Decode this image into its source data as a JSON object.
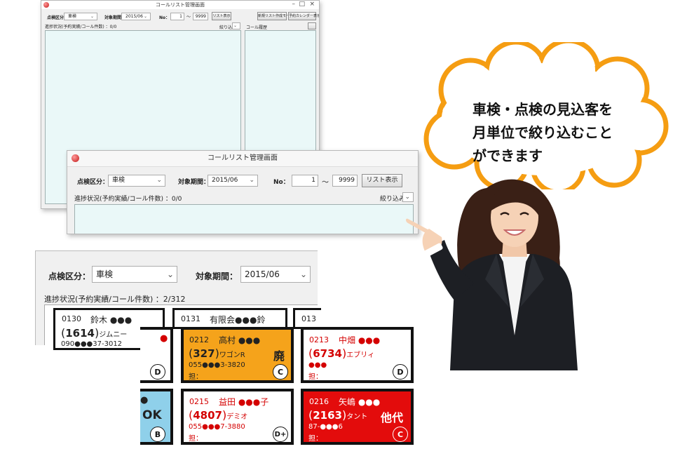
{
  "window_back": {
    "title": "コールリスト管理画面",
    "inspection_label": "点検区分：",
    "inspection_value": "車検",
    "period_label": "対象期間：",
    "period_value": "2015/06",
    "no_label": "No：",
    "no_from": "1",
    "tilde": "～",
    "no_to": "9999",
    "list_button": "リスト表示",
    "new_list_button": "新規リスト作成モード",
    "calendar_button": "予約カレンダー表示",
    "progress": "進捗状況(予約実績/コール件数) ：0/0",
    "filter_label": "絞り込み",
    "history_label": "コール履歴",
    "controls": [
      "–",
      "□",
      "×"
    ]
  },
  "window_front": {
    "title": "コールリスト管理画面",
    "inspection_label": "点検区分：",
    "inspection_value": "車検",
    "period_label": "対象期間：",
    "period_value": "2015/06",
    "no_label": "No：",
    "no_from": "1",
    "tilde": "～",
    "no_to": "9999",
    "list_button": "リスト表示",
    "progress": "進捗状況(予約実績/コール件数) ：0/0",
    "filter_label": "絞り込み"
  },
  "zoom": {
    "inspection_label": "点検区分：",
    "inspection_value": "車検",
    "period_label": "対象期間：",
    "period_value": "2015/06",
    "progress": "進捗状況(予約実績/コール件数) ：2/312"
  },
  "cards_back": [
    {
      "no": "0130",
      "name": "鈴木 ●●●",
      "num": "1614",
      "car": "ジムニー",
      "tel": "090●●●37-3012"
    },
    {
      "no": "0131",
      "name": "有限会●●●鈴"
    },
    {
      "no": "013"
    }
  ],
  "cards": [
    {
      "no": "",
      "name": "●",
      "num": "",
      "car": "",
      "tel": "",
      "person": "",
      "tag": "",
      "grade": "D"
    },
    {
      "no": "0212",
      "name": "高村 ●●●",
      "num": "327",
      "car": "ワゴンR",
      "tel": "055●●●3-3820",
      "person": "担：",
      "tag": "廃",
      "grade": "C"
    },
    {
      "no": "0213",
      "name": "中畑 ●●●",
      "num": "6734",
      "car": "エブリィ",
      "tel": "●●●",
      "person": "担：",
      "tag": "",
      "grade": "D"
    },
    {
      "no": "",
      "name": "●",
      "num": "",
      "car": "",
      "tel": "",
      "person": "",
      "tag": "OK",
      "grade": "B"
    },
    {
      "no": "0215",
      "name": "益田 ●●●子",
      "num": "4807",
      "car": "デミオ",
      "tel": "055●●●7-3880",
      "person": "担：",
      "tag": "",
      "grade": "D+"
    },
    {
      "no": "0216",
      "name": "矢嶋 ●●●",
      "num": "2163",
      "car": "タント",
      "tel": "87-●●●6",
      "person": "担：",
      "tag": "他代",
      "grade": "C"
    }
  ],
  "callout": {
    "lines": [
      "車検・点検の見込客を",
      "月単位で絞り込むこと",
      "ができます"
    ]
  },
  "colors": {
    "panel_bg": "#eaf8f8",
    "card_orange": "#f5a31b",
    "card_blue": "#8fd0ea",
    "card_red": "#e30c0c",
    "text_red": "#d40000",
    "cloud_orange": "#f59d12"
  }
}
